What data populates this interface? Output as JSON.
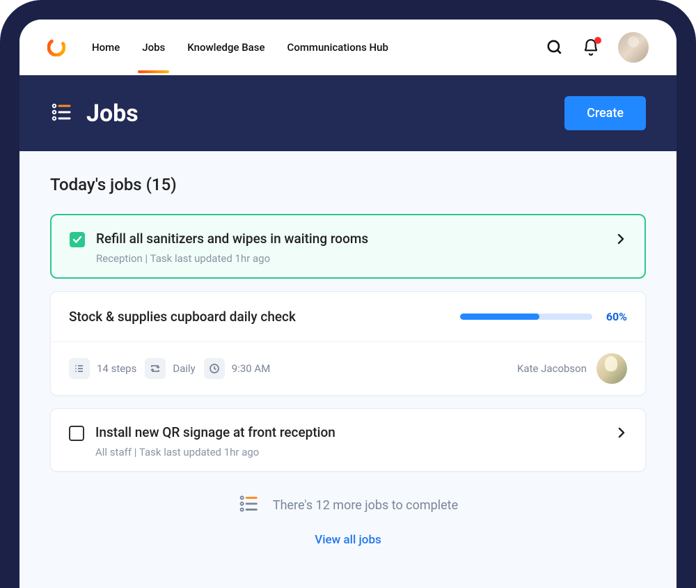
{
  "nav": {
    "items": [
      {
        "label": "Home"
      },
      {
        "label": "Jobs"
      },
      {
        "label": "Knowledge Base"
      },
      {
        "label": "Communications Hub"
      }
    ],
    "active_index": 1
  },
  "page": {
    "title": "Jobs",
    "create_label": "Create"
  },
  "section": {
    "title": "Today's jobs (15)"
  },
  "jobs": {
    "done": {
      "title": "Refill all sanitizers and wipes in waiting rooms",
      "meta": "Reception   |   Task last updated 1hr ago"
    },
    "progress": {
      "title": "Stock & supplies cupboard daily check",
      "percent": 60,
      "percent_label": "60%",
      "steps": "14 steps",
      "frequency": "Daily",
      "time": "9:30 AM",
      "assignee": "Kate Jacobson"
    },
    "todo": {
      "title": "Install new QR signage at front reception",
      "meta": "All staff   |   Task last updated 1hr ago"
    }
  },
  "footer": {
    "more_text": "There's 12 more jobs to complete",
    "view_all": "View all jobs"
  }
}
